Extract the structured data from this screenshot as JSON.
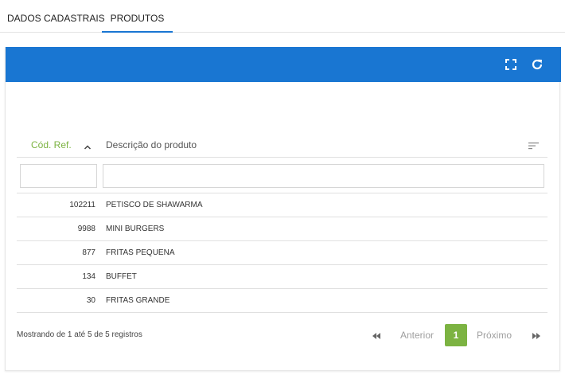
{
  "tabs": [
    {
      "label": "DADOS CADASTRAIS",
      "active": false
    },
    {
      "label": "PRODUTOS",
      "active": true
    }
  ],
  "colors": {
    "header_blue": "#1976d2",
    "accent_green": "#7cb342",
    "border": "#e0e0e0"
  },
  "panel": {
    "icons": [
      "fullscreen-icon",
      "refresh-icon"
    ]
  },
  "table": {
    "columns": [
      {
        "label": "Cód. Ref.",
        "sorted": "asc"
      },
      {
        "label": "Descrição do produto"
      }
    ],
    "filters": [
      {
        "value": "",
        "placeholder": ""
      },
      {
        "value": "",
        "placeholder": ""
      }
    ],
    "rows": [
      {
        "code": "102211",
        "description": "PETISCO DE SHAWARMA"
      },
      {
        "code": "9988",
        "description": "MINI BURGERS"
      },
      {
        "code": "877",
        "description": "FRITAS PEQUENA"
      },
      {
        "code": "134",
        "description": "BUFFET"
      },
      {
        "code": "30",
        "description": "FRITAS GRANDE"
      }
    ]
  },
  "pagination": {
    "info": "Mostrando de 1 até 5 de 5 registros",
    "prev_label": "Anterior",
    "current_page": "1",
    "next_label": "Próximo"
  }
}
